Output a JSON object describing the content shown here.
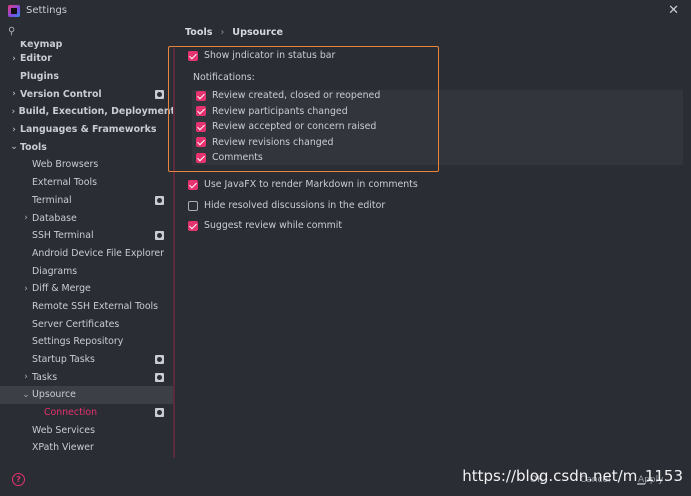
{
  "window": {
    "title": "Settings"
  },
  "breadcrumb": {
    "parent": "Tools",
    "separator": "›",
    "current": "Upsource"
  },
  "sidebar": {
    "items": [
      {
        "label": "Keymap",
        "arrow": "",
        "indent": 0,
        "bold": true,
        "cut": true
      },
      {
        "label": "Editor",
        "arrow": "›",
        "indent": 0,
        "bold": true
      },
      {
        "label": "Plugins",
        "arrow": "",
        "indent": 0,
        "bold": true
      },
      {
        "label": "Version Control",
        "arrow": "›",
        "indent": 0,
        "bold": true,
        "scope": true
      },
      {
        "label": "Build, Execution, Deployment",
        "arrow": "›",
        "indent": 0,
        "bold": true
      },
      {
        "label": "Languages & Frameworks",
        "arrow": "›",
        "indent": 0,
        "bold": true
      },
      {
        "label": "Tools",
        "arrow": "⌄",
        "indent": 0,
        "bold": true
      },
      {
        "label": "Web Browsers",
        "arrow": "",
        "indent": 1
      },
      {
        "label": "External Tools",
        "arrow": "",
        "indent": 1
      },
      {
        "label": "Terminal",
        "arrow": "",
        "indent": 1,
        "scope": true
      },
      {
        "label": "Database",
        "arrow": "›",
        "indent": 1
      },
      {
        "label": "SSH Terminal",
        "arrow": "",
        "indent": 1,
        "scope": true
      },
      {
        "label": "Android Device File Explorer",
        "arrow": "",
        "indent": 1
      },
      {
        "label": "Diagrams",
        "arrow": "",
        "indent": 1
      },
      {
        "label": "Diff & Merge",
        "arrow": "›",
        "indent": 1
      },
      {
        "label": "Remote SSH External Tools",
        "arrow": "",
        "indent": 1
      },
      {
        "label": "Server Certificates",
        "arrow": "",
        "indent": 1
      },
      {
        "label": "Settings Repository",
        "arrow": "",
        "indent": 1
      },
      {
        "label": "Startup Tasks",
        "arrow": "",
        "indent": 1,
        "scope": true
      },
      {
        "label": "Tasks",
        "arrow": "›",
        "indent": 1,
        "scope": true
      },
      {
        "label": "Upsource",
        "arrow": "⌄",
        "indent": 1,
        "selected": true
      },
      {
        "label": "Connection",
        "arrow": "",
        "indent": 2,
        "active": true,
        "scope": true
      },
      {
        "label": "Web Services",
        "arrow": "",
        "indent": 1
      },
      {
        "label": "XPath Viewer",
        "arrow": "",
        "indent": 1
      }
    ]
  },
  "options": {
    "show_indicator": {
      "label": "Show jndicator in status bar",
      "checked": true
    },
    "notifications_label": "Notifications:",
    "notifications": [
      {
        "label": "Review created, closed or reopened",
        "checked": true
      },
      {
        "label": "Review participants changed",
        "checked": true
      },
      {
        "label": "Review accepted or concern raised",
        "checked": true
      },
      {
        "label": "Review revisions changed",
        "checked": true
      },
      {
        "label": "Comments",
        "checked": true
      }
    ],
    "use_javafx": {
      "label": "Use JavaFX to render Markdown in comments",
      "checked": true
    },
    "hide_resolved": {
      "label": "Hide resolved discussions in the editor",
      "checked": false
    },
    "suggest_review": {
      "label": "Suggest review while commit",
      "checked": true
    }
  },
  "footer": {
    "help": "?",
    "ok_label": "OK",
    "cancel_label": "Cancel",
    "apply_label": "Apply",
    "watermark": "https://blog.csdn.net/m_1153"
  },
  "colors": {
    "accent": "#e6326e",
    "highlight_border": "#e9853a",
    "background": "#2b2d34"
  }
}
